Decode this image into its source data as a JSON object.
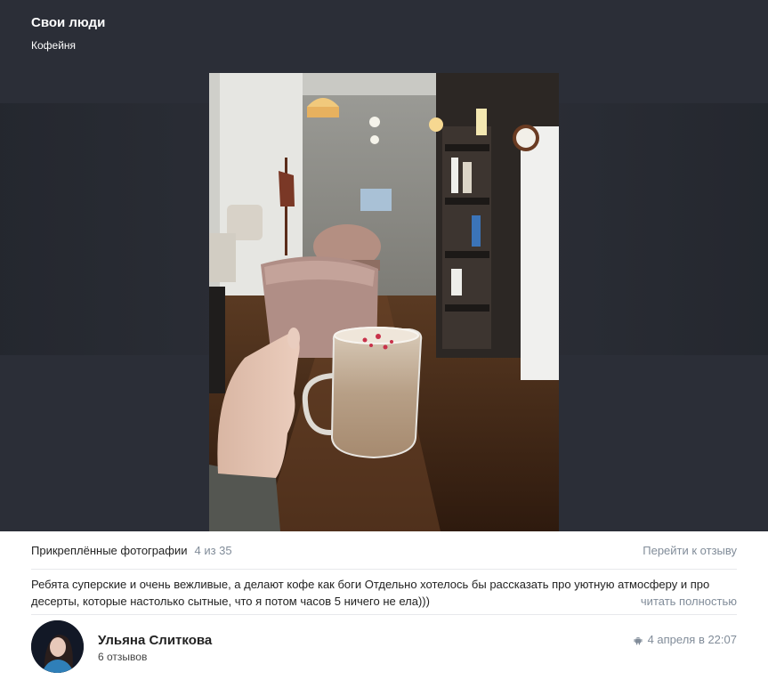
{
  "header": {
    "title": "Свои люди",
    "subtitle": "Кофейня"
  },
  "photo": {
    "icon": "coffee-photo"
  },
  "attachments": {
    "label": "Прикреплённые фотографии",
    "counter": "4 из 35",
    "goto_label": "Перейти к отзыву"
  },
  "review": {
    "text": "Ребята суперские и очень вежливые, а делают кофе как боги Отдельно хотелось бы рассказать про уютную атмосферу и про десерты, которые настолько сытные, что я потом часов 5 ничего не ела)))",
    "read_more": "читать полностью"
  },
  "author": {
    "name": "Ульяна Слиткова",
    "reviews_count": "6 отзывов",
    "date": "4 апреля в 22:07",
    "platform_icon": "android-icon"
  },
  "colors": {
    "viewer_bg": "#2b2e37",
    "muted": "#818c99",
    "divider": "#e7e8ec"
  }
}
